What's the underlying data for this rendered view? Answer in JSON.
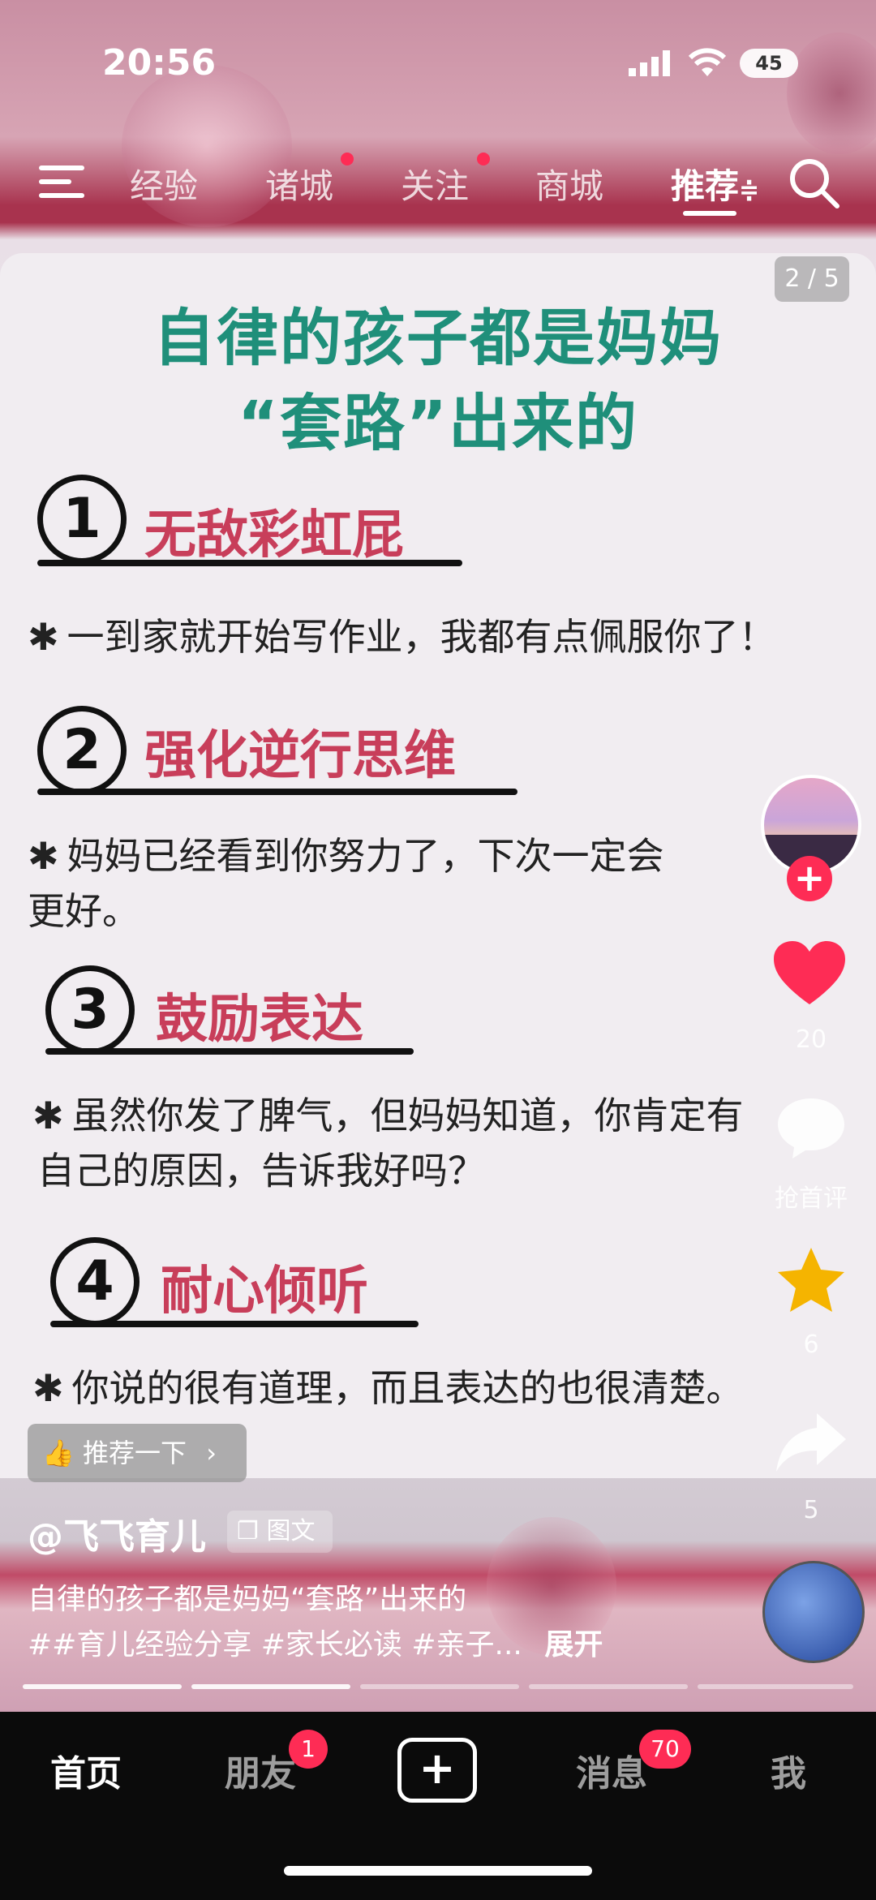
{
  "status": {
    "time": "20:56",
    "battery": "45"
  },
  "top_tabs": [
    {
      "label": "经验",
      "dot": false
    },
    {
      "label": "诸城",
      "dot": true
    },
    {
      "label": "关注",
      "dot": true
    },
    {
      "label": "商城",
      "dot": false
    },
    {
      "label": "推荐",
      "dot": false,
      "active": true,
      "suffix": "≑"
    }
  ],
  "post": {
    "pager": "2 / 5",
    "title_line1": "自律的孩子都是妈妈",
    "title_line2": "“套路”出来的",
    "sections": [
      {
        "num": "1",
        "heading": "无敌彩虹屁",
        "text": "一到家就开始写作业，我都有点佩服你了！"
      },
      {
        "num": "2",
        "heading": "强化逆行思维",
        "text": "妈妈已经看到你努力了，下次一定会",
        "text2": "更好。"
      },
      {
        "num": "3",
        "heading": "鼓励表达",
        "text": "虽然你发了脾气，但妈妈知道，你肯定有",
        "text2": "自己的原因，告诉我好吗？"
      },
      {
        "num": "4",
        "heading": "耐心倾听",
        "text": "你说的很有道理，而且表达的也很清楚。"
      }
    ],
    "recommend_label": "推荐一下",
    "author": "@飞飞育儿",
    "type_tag": "图文",
    "caption": "自律的孩子都是妈妈“套路”出来的",
    "hashtags": "##育儿经验分享 #家长必读 #亲子...",
    "expand": "展开",
    "progress": {
      "current": 2,
      "total": 5
    }
  },
  "sidebar": {
    "likes": "20",
    "comment_label": "抢首评",
    "favorites": "6",
    "shares": "5"
  },
  "bottom_nav": {
    "home": "首页",
    "friends": "朋友",
    "friends_badge": "1",
    "messages": "消息",
    "messages_badge": "70",
    "me": "我"
  },
  "colors": {
    "accent": "#fe2c55",
    "title_green": "#1f8f7a",
    "heading_red": "#c83e5a",
    "star_yellow": "#f5b400"
  }
}
